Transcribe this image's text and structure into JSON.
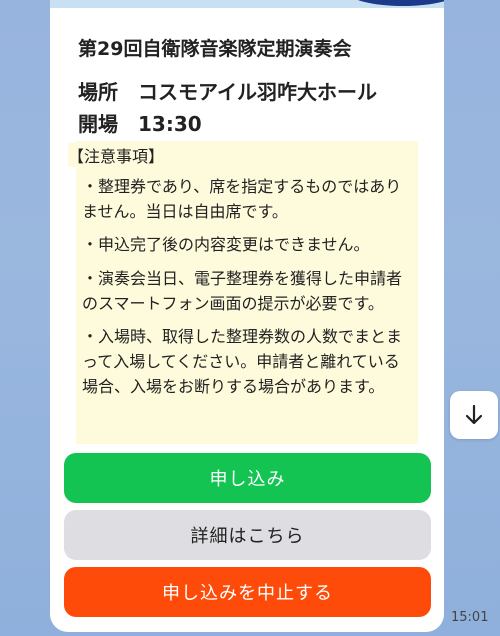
{
  "event": {
    "title": "第29回自衛隊音楽隊定期演奏会",
    "venue_label": "場所",
    "venue": "コスモアイル羽咋大ホール",
    "open_label": "開場",
    "open_time": "13:30"
  },
  "notice": {
    "heading": "【注意事項】",
    "items": [
      "・整理券であり、席を指定するものではありません。当日は自由席です。",
      "・申込完了後の内容変更はできません。",
      "・演奏会当日、電子整理券を獲得した申請者のスマートフォン画面の提示が必要です。",
      "・入場時、取得した整理券数の人数でまとまって入場してください。申請者と離れている場合、入場をお断りする場合があります。"
    ]
  },
  "buttons": {
    "apply": "申し込み",
    "details": "詳細はこちら",
    "cancel": "申し込みを中止する"
  },
  "icons": {
    "scroll": "arrow-down-icon"
  },
  "message_time": "15:01",
  "colors": {
    "apply": "#13c453",
    "details": "#dddde2",
    "cancel": "#ff4b0a",
    "notice_bg": "#fefbdc"
  }
}
